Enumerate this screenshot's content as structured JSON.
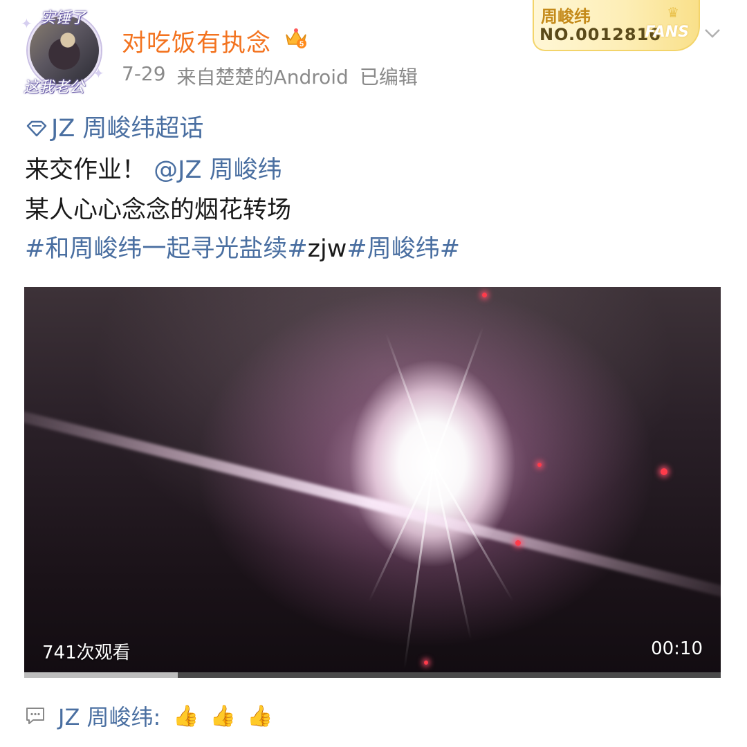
{
  "author": {
    "name": "对吃饭有执念",
    "avatar_frame_top": "实锤了",
    "avatar_frame_bottom": "这我老公",
    "vip_icon": "crown-vip-icon",
    "vip_level": "5"
  },
  "meta": {
    "date": "7-29",
    "source": "来自楚楚的Android",
    "edited": "已编辑"
  },
  "fans_badge": {
    "name": "周峻纬",
    "number": "NO.0012816",
    "word": "FANS"
  },
  "post": {
    "topic": "JZ 周峻纬超话",
    "line2_text": "来交作业！",
    "line2_mention": "@JZ 周峻纬",
    "line3": "某人心心念念的烟花转场",
    "hashtag1": "#和周峻纬一起寻光盐续#",
    "hashtag2": "zjw",
    "hashtag3": "#周峻纬#"
  },
  "video": {
    "views": "741次观看",
    "duration": "00:10",
    "progress": 0.22
  },
  "comment": {
    "author": "JZ 周峻纬",
    "separator": ":",
    "emoji": "👍",
    "emoji_count": 3
  },
  "colors": {
    "username": "#f3731f",
    "link": "#4a6fa1",
    "meta": "#8a8a8a"
  }
}
